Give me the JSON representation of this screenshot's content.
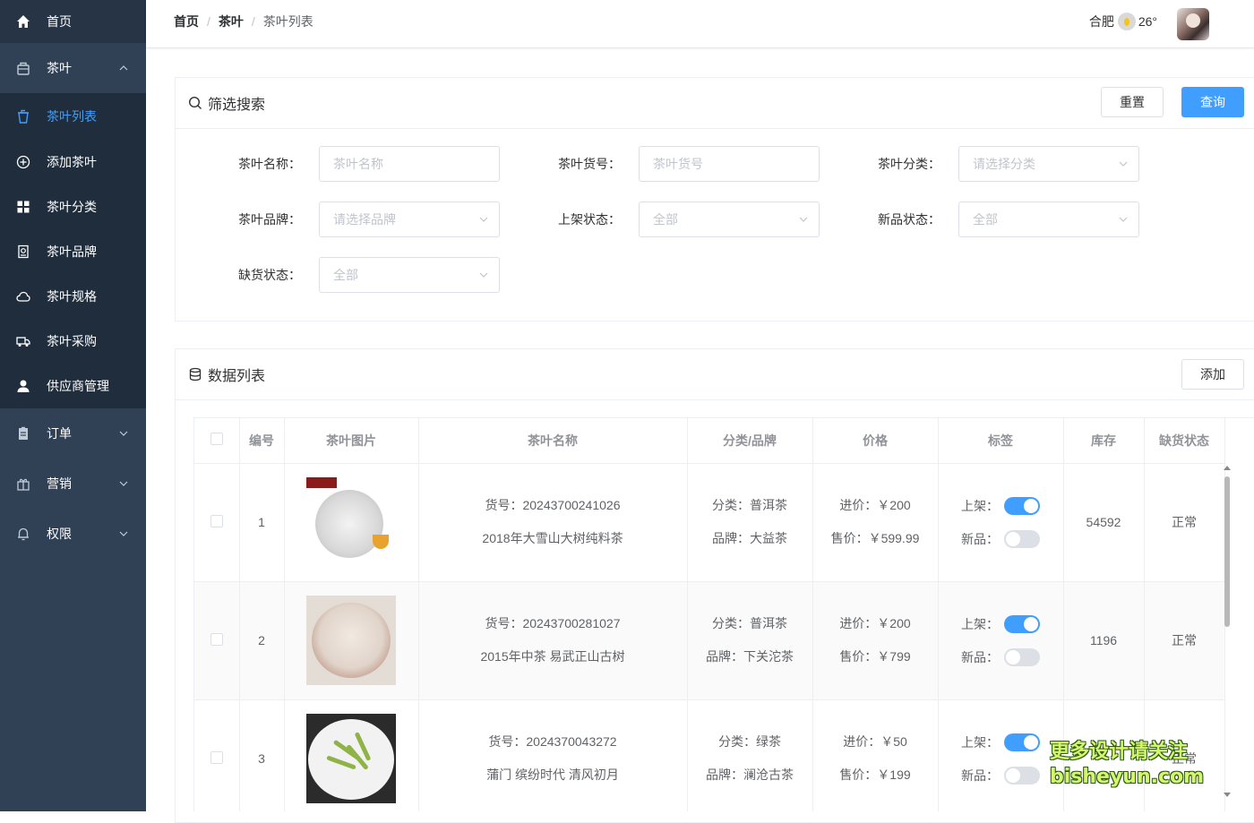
{
  "sidebar": {
    "items": [
      {
        "label": "首页",
        "icon": "home-icon"
      },
      {
        "label": "茶叶",
        "icon": "bag-icon"
      },
      {
        "label": "茶叶列表",
        "icon": "cup-icon"
      },
      {
        "label": "添加茶叶",
        "icon": "add-circle-icon"
      },
      {
        "label": "茶叶分类",
        "icon": "grid-icon"
      },
      {
        "label": "茶叶品牌",
        "icon": "badge-icon"
      },
      {
        "label": "茶叶规格",
        "icon": "cloud-icon"
      },
      {
        "label": "茶叶采购",
        "icon": "truck-icon"
      },
      {
        "label": "供应商管理",
        "icon": "user-icon"
      },
      {
        "label": "订单",
        "icon": "document-icon"
      },
      {
        "label": "营销",
        "icon": "gift-icon"
      },
      {
        "label": "权限",
        "icon": "bell-icon"
      }
    ],
    "active_color": "#409eff"
  },
  "header": {
    "breadcrumb": [
      "首页",
      "茶叶",
      "茶叶列表"
    ],
    "separator": "/",
    "city": "合肥",
    "temperature": "26°"
  },
  "filter": {
    "title": "筛选搜索",
    "reset_label": "重置",
    "query_label": "查询",
    "fields": [
      {
        "label": "茶叶名称：",
        "placeholder": "茶叶名称"
      },
      {
        "label": "茶叶货号：",
        "placeholder": "茶叶货号"
      },
      {
        "label": "茶叶分类：",
        "placeholder": "请选择分类"
      },
      {
        "label": "茶叶品牌：",
        "placeholder": "请选择品牌"
      },
      {
        "label": "上架状态：",
        "placeholder": "全部"
      },
      {
        "label": "新品状态：",
        "placeholder": "全部"
      },
      {
        "label": "缺货状态：",
        "placeholder": "全部"
      }
    ]
  },
  "list": {
    "title": "数据列表",
    "add_label": "添加",
    "columns": [
      "编号",
      "茶叶图片",
      "茶叶名称",
      "分类/品牌",
      "价格",
      "标签",
      "库存",
      "缺货状态"
    ],
    "rows": [
      {
        "id": "1",
        "sku": "货号：20243700241026",
        "name": "2018年大雪山大树纯料茶",
        "category": "分类：普洱茶",
        "brand": "品牌：大益茶",
        "cost": "进价：￥200",
        "price": "售价：￥599.99",
        "shelf_label": "上架：",
        "new_label": "新品：",
        "shelf_on": true,
        "new_on": false,
        "stock": "54592",
        "status": "正常"
      },
      {
        "id": "2",
        "sku": "货号：20243700281027",
        "name": "2015年中茶 易武正山古树",
        "category": "分类：普洱茶",
        "brand": "品牌：下关沱茶",
        "cost": "进价：￥200",
        "price": "售价：￥799",
        "shelf_label": "上架：",
        "new_label": "新品：",
        "shelf_on": true,
        "new_on": false,
        "stock": "1196",
        "status": "正常"
      },
      {
        "id": "3",
        "sku": "货号：2024370043272",
        "name": "蒲门 缤纷时代 清风初月",
        "category": "分类：绿茶",
        "brand": "品牌：澜沧古茶",
        "cost": "进价：￥50",
        "price": "售价：￥199",
        "shelf_label": "上架：",
        "new_label": "新品：",
        "shelf_on": true,
        "new_on": false,
        "stock": "",
        "status": "正常"
      }
    ]
  },
  "watermark": {
    "line1": "更多设计请关注",
    "line2": "bisheyun.com"
  }
}
